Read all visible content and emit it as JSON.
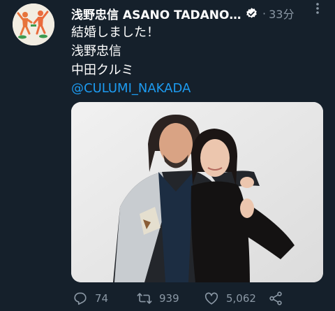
{
  "tweet": {
    "author_name": "浅野忠信 ASANO TADANOBU",
    "time_separator": "·",
    "time": "33分",
    "lines": [
      "結婚しました！",
      "浅野忠信",
      "中田クルミ"
    ],
    "mention": "@CULUMI_NAKADA"
  },
  "actions": {
    "replies": "74",
    "retweets": "939",
    "likes": "5,062"
  },
  "icons": {
    "avatar": "avatar-illustration",
    "verified": "verified-badge-icon",
    "more": "more-icon",
    "reply": "reply-icon",
    "retweet": "retweet-icon",
    "like": "heart-icon",
    "share": "share-icon"
  },
  "colors": {
    "background": "#15202b",
    "text": "#ffffff",
    "secondary": "#8b98a5",
    "link": "#1d9bf0"
  }
}
